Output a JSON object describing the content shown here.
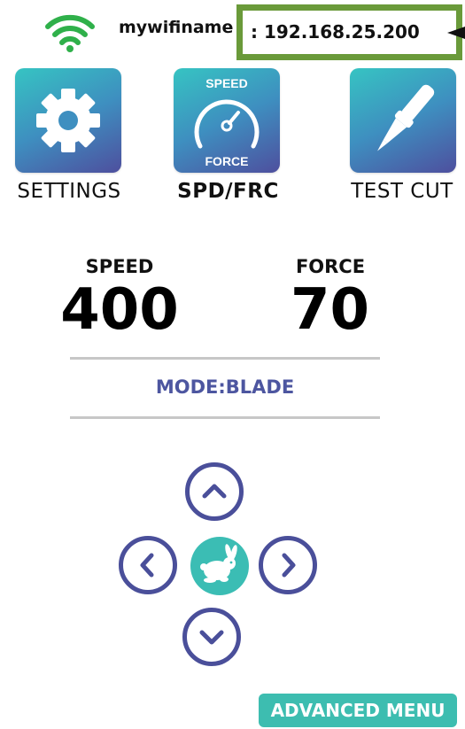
{
  "header": {
    "wifi_icon": "wifi-icon",
    "ssid": "mywifiname",
    "ip": ": 192.168.25.200"
  },
  "tiles": [
    {
      "label": "SETTINGS",
      "icon": "gear-icon"
    },
    {
      "label": "SPD/FRC",
      "icon": "speedometer-icon",
      "top_text": "SPEED",
      "bottom_text": "FORCE"
    },
    {
      "label": "TEST CUT",
      "icon": "blade-pen-icon"
    }
  ],
  "values": {
    "speed_label": "SPEED",
    "speed": "400",
    "force_label": "FORCE",
    "force": "70"
  },
  "mode": "MODE:BLADE",
  "dpad": {
    "up_icon": "chevron-up-icon",
    "down_icon": "chevron-down-icon",
    "left_icon": "chevron-left-icon",
    "right_icon": "chevron-right-icon",
    "center_icon": "rabbit-icon"
  },
  "advanced_menu": "ADVANCED MENU",
  "colors": {
    "accent_teal": "#3dbdb0",
    "accent_indigo": "#4a4f9a",
    "highlight_green": "#6a9a3a",
    "wifi_green": "#2fb04a"
  }
}
